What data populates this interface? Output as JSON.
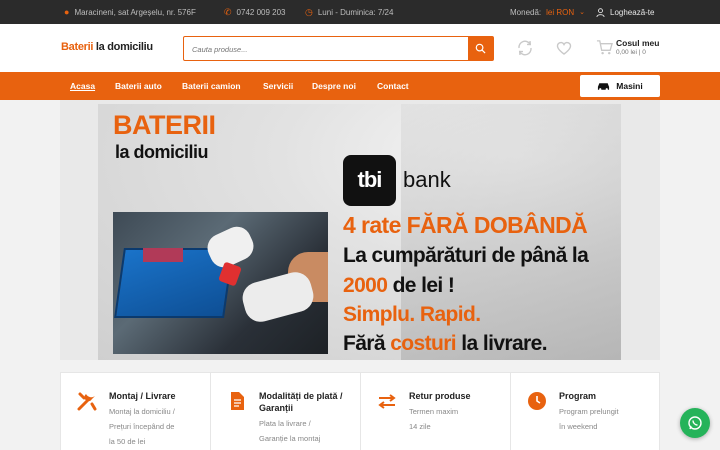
{
  "topbar": {
    "address": "Maracineni, sat Argeșelu, nr. 576F",
    "phone": "0742 009 203",
    "hours": "Luni - Duminica: 7/24",
    "currency_label": "Monedă:",
    "currency_value": "lei RON",
    "login": "Loghează-te"
  },
  "header": {
    "logo_part1": "Baterii",
    "logo_part2": "la domiciliu",
    "search_placeholder": "Cauta produse...",
    "cart_title": "Cosul meu",
    "cart_summary": "0,00 lei | 0"
  },
  "nav": {
    "items": [
      "Acasa",
      "Baterii auto",
      "Baterii camion",
      "Servicii",
      "Despre noi",
      "Contact"
    ],
    "active": "Acasa",
    "masini_label": "Masini"
  },
  "banner": {
    "title1": "BATERII",
    "title2": "la domiciliu",
    "tbi_logo": "tbi",
    "tbi_bank": "bank",
    "line1": "4 rate FĂRĂ DOBÂNDĂ",
    "line2": "La cumpărături de până la",
    "line3_amount": "2000",
    "line3_rest": "de lei !",
    "line4": "Simplu. Rapid.",
    "line5_a": "Fără",
    "line5_b": "costuri",
    "line5_c": "la livrare."
  },
  "features": [
    {
      "title": "Montaj / Livrare",
      "desc": [
        "Montaj la domiciliu /",
        "Prețuri începând de",
        "la 50 de lei"
      ],
      "icon": "tools-icon"
    },
    {
      "title": "Modalități de plată / Garanții",
      "desc": [
        "Plata la livrare /",
        "Garanție la montaj"
      ],
      "icon": "document-icon"
    },
    {
      "title": "Retur produse",
      "desc": [
        "Termen maxim",
        "14 zile"
      ],
      "icon": "exchange-icon"
    },
    {
      "title": "Program",
      "desc": [
        "Program prelungit",
        "în weekend"
      ],
      "icon": "clock-icon"
    }
  ],
  "colors": {
    "accent": "#e8620f",
    "topbar": "#2b2b2b",
    "whatsapp": "#25b35a"
  }
}
